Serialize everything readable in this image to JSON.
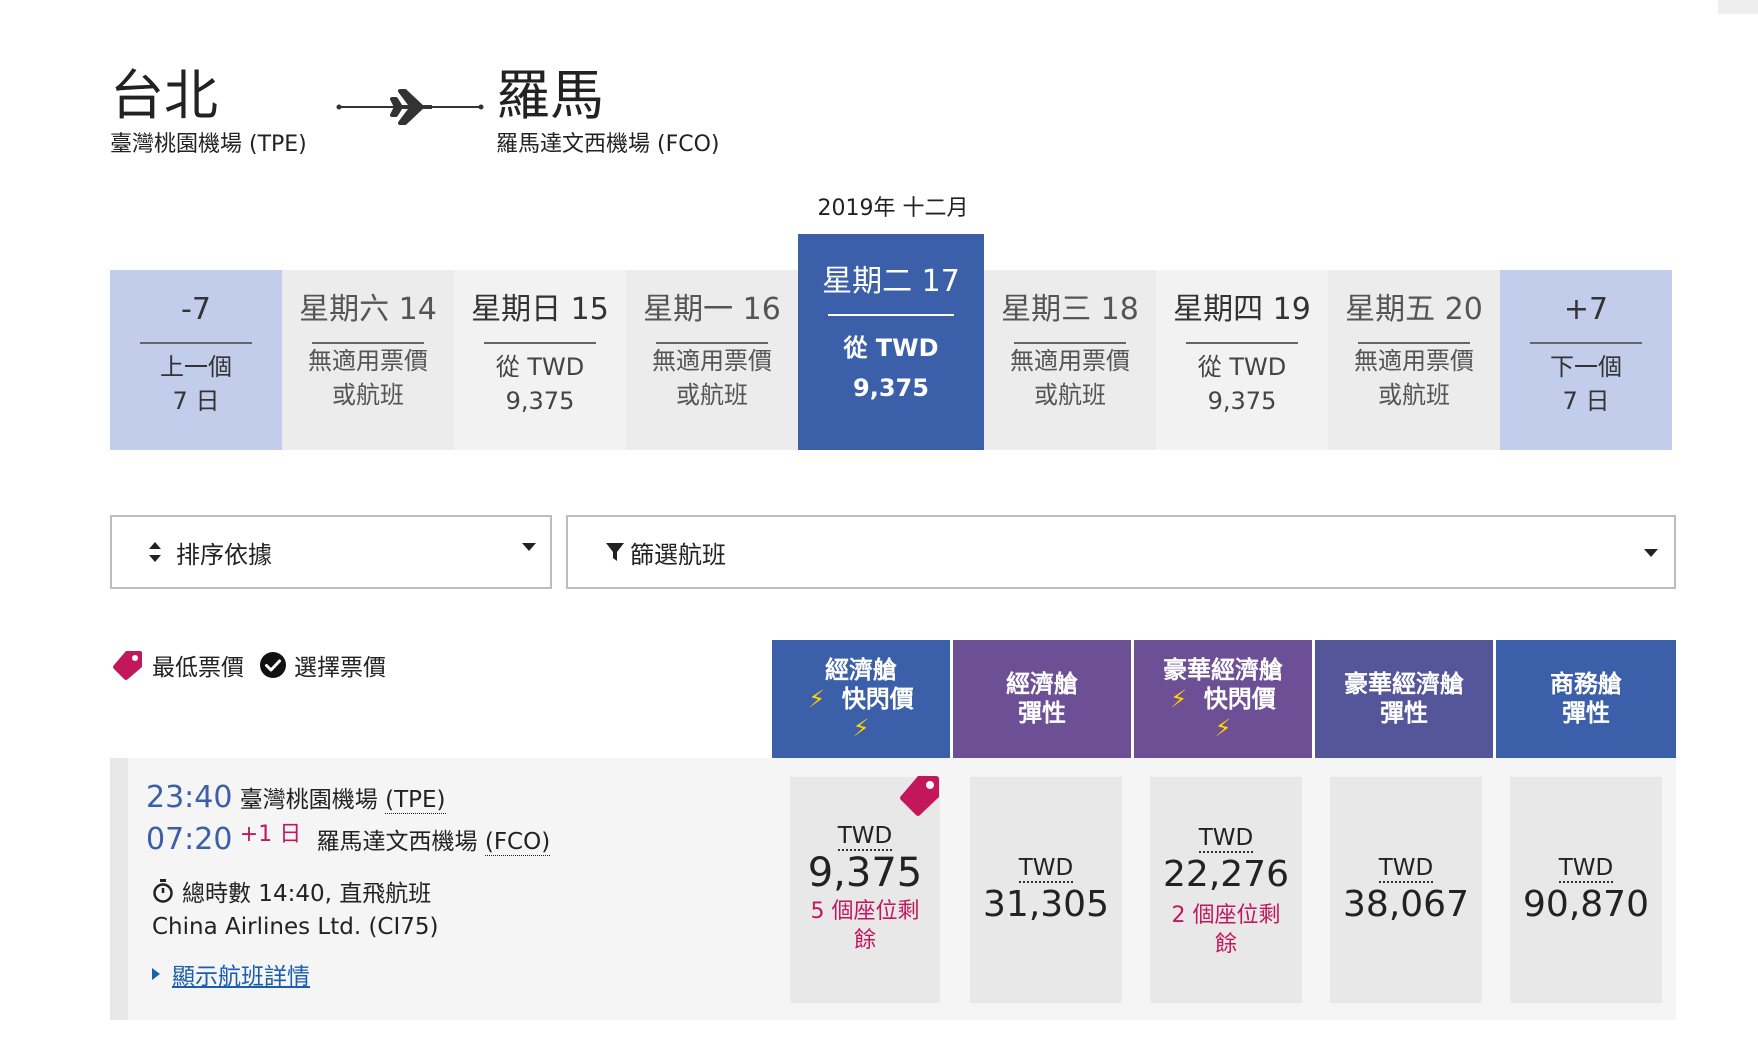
{
  "route": {
    "origin_city": "台北",
    "origin_airport": "臺灣桃園機場 (TPE)",
    "destination_city": "羅馬",
    "destination_airport": "羅馬達文西機場 (FCO)"
  },
  "month_label": "2019年 十二月",
  "date_strip": {
    "prev": {
      "label": "-7",
      "line1": "上一個",
      "line2": "7 日"
    },
    "days": [
      {
        "label": "星期六 14",
        "line1": "無適用票價",
        "line2": "或航班"
      },
      {
        "label": "星期日 15",
        "line1": "從 TWD",
        "line2": "9,375"
      },
      {
        "label": "星期一 16",
        "line1": "無適用票價",
        "line2": "或航班"
      },
      {
        "label": "星期二 17",
        "line1": "從 TWD",
        "line2": "9,375"
      },
      {
        "label": "星期三 18",
        "line1": "無適用票價",
        "line2": "或航班"
      },
      {
        "label": "星期四 19",
        "line1": "從 TWD",
        "line2": "9,375"
      },
      {
        "label": "星期五 20",
        "line1": "無適用票價",
        "line2": "或航班"
      }
    ],
    "next": {
      "label": "+7",
      "line1": "下一個",
      "line2": "7 日"
    }
  },
  "sort": {
    "label": "排序依據"
  },
  "filter": {
    "label": "篩選航班"
  },
  "legend": {
    "lowest": "最低票價",
    "selected": "選擇票價"
  },
  "cabins": [
    {
      "line1": "經濟艙",
      "line2": "快閃價",
      "color": "#3b5fa8"
    },
    {
      "line1": "經濟艙",
      "line2": "彈性",
      "color": "#6d4f96"
    },
    {
      "line1": "豪華經濟艙",
      "line2": "快閃價",
      "color": "#6d4f96"
    },
    {
      "line1": "豪華經濟艙",
      "line2": "彈性",
      "color": "#55559a"
    },
    {
      "line1": "商務艙",
      "line2": "彈性",
      "color": "#3b5fa8"
    }
  ],
  "flight": {
    "depart_time": "23:40",
    "depart_airport": "臺灣桃園機場",
    "depart_code": "(TPE)",
    "arrive_time": "07:20",
    "arrive_plus": "+1 日",
    "arrive_airport": "羅馬達文西機場",
    "arrive_code": "(FCO)",
    "duration": "總時數 14:40, 直飛航班",
    "carrier": "China Airlines Ltd. (CI75)",
    "details_link": "顯示航班詳情",
    "fares": [
      {
        "currency": "TWD",
        "amount": "9,375",
        "seats_1": "5 個座位剩",
        "seats_2": "餘"
      },
      {
        "currency": "TWD",
        "amount": "31,305"
      },
      {
        "currency": "TWD",
        "amount": "22,276",
        "seats_1": "2 個座位剩",
        "seats_2": "餘"
      },
      {
        "currency": "TWD",
        "amount": "38,067"
      },
      {
        "currency": "TWD",
        "amount": "90,870"
      }
    ]
  }
}
